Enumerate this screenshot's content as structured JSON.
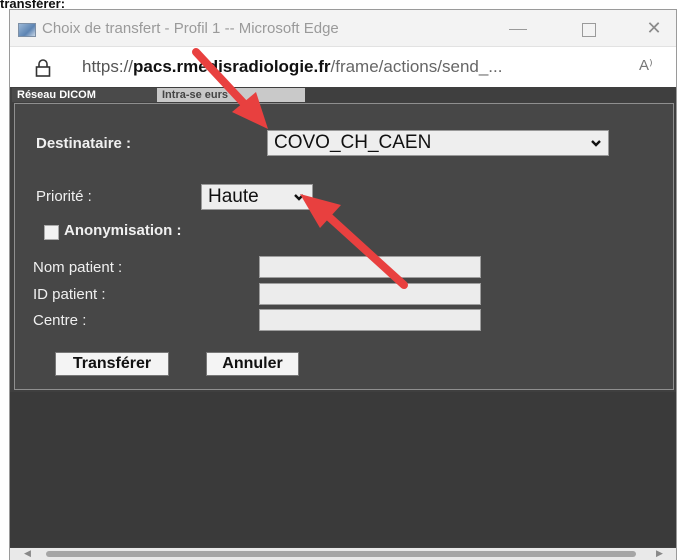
{
  "caption": "transférer:",
  "window": {
    "title": "Choix de transfert - Profil 1 -- Microsoft Edge",
    "minimize_icon": "minimize-icon",
    "maximize_icon": "maximize-icon",
    "close_glyph": "✕"
  },
  "address_bar": {
    "scheme": "https://",
    "host": "pacs.",
    "host_rest": "rmedisradiologie.fr",
    "path": "/frame/actions/send_...",
    "read_aloud_glyph": "A⁾"
  },
  "tabs": [
    {
      "label": "Réseau DICOM"
    },
    {
      "label": "Intra-se  eurs"
    }
  ],
  "form": {
    "destinataire_label": "Destinataire :",
    "destinataire_value": "COVO_CH_CAEN",
    "priorite_label": "Priorité :",
    "priorite_value": "Haute",
    "anonymisation_label": "Anonymisation :",
    "anonymisation_checked": false,
    "nom_patient_label": "Nom patient :",
    "nom_patient_value": "",
    "id_patient_label": "ID patient :",
    "id_patient_value": "",
    "centre_label": "Centre :",
    "centre_value": "",
    "transferer_label": "Transférer",
    "annuler_label": "Annuler"
  },
  "annotations": {
    "arrow_color": "#e8403f"
  }
}
